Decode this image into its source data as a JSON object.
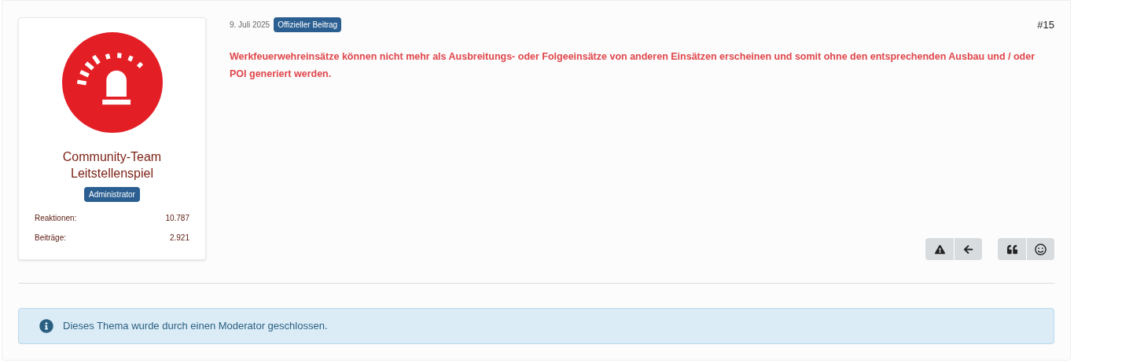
{
  "author": {
    "name_lines": [
      "Community-Team",
      "Leitstellenspiel"
    ],
    "role_badge": "Administrator",
    "stats": [
      {
        "label": "Reaktionen:",
        "value": "10.787"
      },
      {
        "label": "Beiträge:",
        "value": "2.921"
      }
    ]
  },
  "post": {
    "date": "9. Juli 2025",
    "official_badge": "Offizieller Beitrag",
    "number": "#15",
    "message": "Werkfeuerwehreinsätze können nicht mehr als Ausbreitungs- oder Folgeeinsätze von anderen Einsätzen erscheinen und somit ohne den entsprechenden Ausbau und / oder POI generiert werden."
  },
  "notice": {
    "text": "Dieses Thema wurde durch einen Moderator geschlossen."
  }
}
